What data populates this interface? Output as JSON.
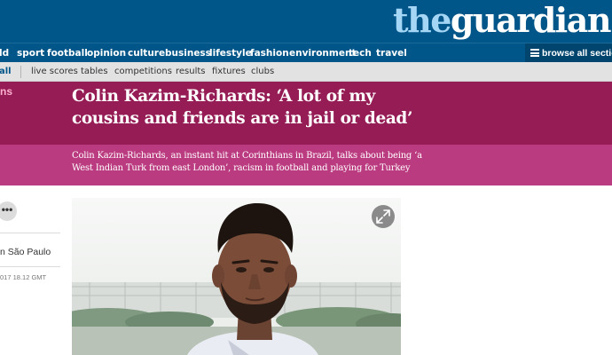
{
  "header": {
    "logo_the": "the",
    "logo_guardian": "guardian"
  },
  "nav": {
    "items": [
      "ld",
      "sport",
      "football",
      "opinion",
      "culture",
      "business",
      "lifestyle",
      "fashion",
      "environment",
      "tech",
      "travel"
    ],
    "browse_label": "browse all sections",
    "browse_icon": "hamburger-icon"
  },
  "subnav": {
    "current": "all",
    "items": [
      "live scores",
      "tables",
      "competitions",
      "results",
      "fixtures",
      "clubs"
    ]
  },
  "article": {
    "section_tag": "ns",
    "headline_line1": "Colin Kazim-Richards: ‘A lot of my",
    "headline_line2": "cousins and friends are in jail or dead’",
    "standfirst_line1": "Colin Kazim-Richards, an instant hit at Corinthians in Brazil, talks about being ‘a",
    "standfirst_line2": "West Indian Turk from east London’, racism in football and playing for Turkey",
    "more_icon": "more-dots-icon",
    "more_label": "•••",
    "location": "n São Paulo",
    "date": "017 18.12 GMT",
    "expand_icon": "expand-icon"
  },
  "colors": {
    "masthead": "#005689",
    "logo_the": "#a5d6f5",
    "headline_band": "#951c55",
    "standfirst_band": "#bb3b80",
    "subnav": "#e2e2e2"
  }
}
